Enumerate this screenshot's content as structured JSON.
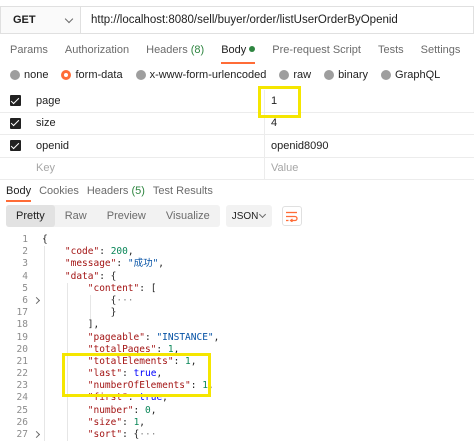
{
  "request": {
    "method": "GET",
    "url": "http://localhost:8080/sell/buyer/order/listUserOrderByOpenid"
  },
  "request_tabs": [
    {
      "label": "Params"
    },
    {
      "label": "Authorization"
    },
    {
      "label": "Headers",
      "count": "(8)"
    },
    {
      "label": "Body",
      "active": true
    },
    {
      "label": "Pre-request Script"
    },
    {
      "label": "Tests"
    },
    {
      "label": "Settings"
    }
  ],
  "body_types": [
    "none",
    "form-data",
    "x-www-form-urlencoded",
    "raw",
    "binary",
    "GraphQL"
  ],
  "body_type_selected": "form-data",
  "params": [
    {
      "key": "page",
      "value": "1"
    },
    {
      "key": "size",
      "value": "4"
    },
    {
      "key": "openid",
      "value": "openid8090"
    }
  ],
  "params_placeholder": {
    "key": "Key",
    "value": "Value"
  },
  "response_tabs": [
    {
      "label": "Body",
      "active": true
    },
    {
      "label": "Cookies"
    },
    {
      "label": "Headers",
      "count": "(5)"
    },
    {
      "label": "Test Results"
    }
  ],
  "view_modes": [
    "Pretty",
    "Raw",
    "Preview",
    "Visualize"
  ],
  "view_mode_active": "Pretty",
  "format": "JSON",
  "icons": {
    "method_dropdown": "chevron-down-icon",
    "wrap": "wrap-lines-icon",
    "fold": "chevron-right-icon"
  },
  "colors": {
    "accent": "#ff6c37",
    "highlight": "#f5e600",
    "success": "#2e8540"
  },
  "code_lines": [
    {
      "ln": "1",
      "text": "{"
    },
    {
      "ln": "2",
      "text": "    \"code\": 200,"
    },
    {
      "ln": "3",
      "text": "    \"message\": \"成功\","
    },
    {
      "ln": "4",
      "text": "    \"data\": {"
    },
    {
      "ln": "5",
      "text": "        \"content\": ["
    },
    {
      "ln": "6",
      "text": "            {···",
      "folded": true
    },
    {
      "ln": "17",
      "text": "            }"
    },
    {
      "ln": "18",
      "text": "        ],"
    },
    {
      "ln": "19",
      "text": "        \"pageable\": \"INSTANCE\","
    },
    {
      "ln": "20",
      "text": "        \"totalPages\": 1,"
    },
    {
      "ln": "21",
      "text": "        \"totalElements\": 1,"
    },
    {
      "ln": "22",
      "text": "        \"last\": true,"
    },
    {
      "ln": "23",
      "text": "        \"numberOfElements\": 1,"
    },
    {
      "ln": "24",
      "text": "        \"first\": true,"
    },
    {
      "ln": "25",
      "text": "        \"number\": 0,"
    },
    {
      "ln": "26",
      "text": "        \"size\": 1,"
    },
    {
      "ln": "27",
      "text": "        \"sort\": {···",
      "folded": true
    }
  ]
}
